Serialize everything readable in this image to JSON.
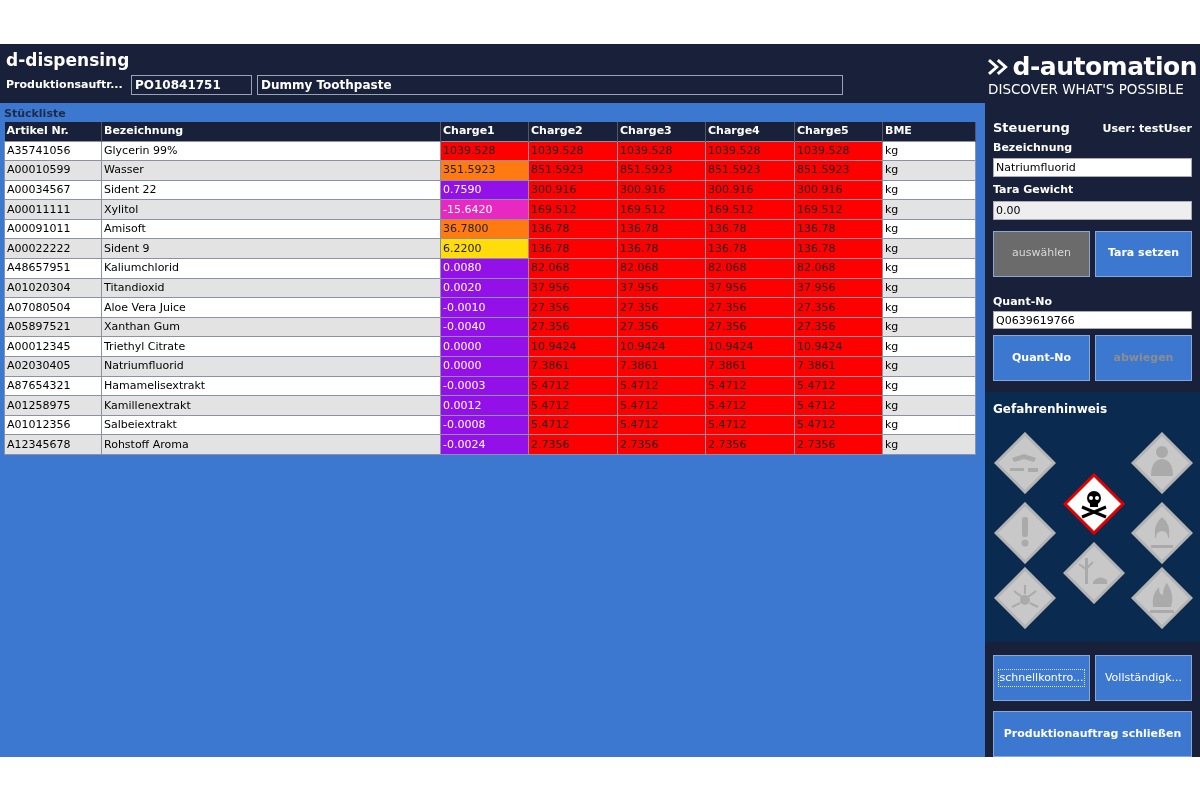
{
  "app": {
    "title": "d-dispensing"
  },
  "order": {
    "label": "Produktionsauftr...",
    "number": "PO10841751",
    "product": "Dummy Toothpaste"
  },
  "bom": {
    "title": "Stückliste",
    "columns": [
      "Artikel Nr.",
      "Bezeichnung",
      "Charge1",
      "Charge2",
      "Charge3",
      "Charge4",
      "Charge5",
      "BME"
    ],
    "rows": [
      {
        "article": "A35741056",
        "name": "Glycerin 99%",
        "charges": [
          {
            "value": "1039.528",
            "color": "#ff0000"
          },
          {
            "value": "1039.528",
            "color": "#ff0000"
          },
          {
            "value": "1039.528",
            "color": "#ff0000"
          },
          {
            "value": "1039.528",
            "color": "#ff0000"
          },
          {
            "value": "1039.528",
            "color": "#ff0000"
          }
        ],
        "unit": "kg"
      },
      {
        "article": "A00010599",
        "name": "Wasser",
        "charges": [
          {
            "value": "351.5923",
            "color": "#ff7a10"
          },
          {
            "value": "851.5923",
            "color": "#ff0000"
          },
          {
            "value": "851.5923",
            "color": "#ff0000"
          },
          {
            "value": "851.5923",
            "color": "#ff0000"
          },
          {
            "value": "851.5923",
            "color": "#ff0000"
          }
        ],
        "unit": "kg"
      },
      {
        "article": "A00034567",
        "name": "Sident 22",
        "charges": [
          {
            "value": "0.7590",
            "color": "#9410e8"
          },
          {
            "value": "300.916",
            "color": "#ff0000"
          },
          {
            "value": "300.916",
            "color": "#ff0000"
          },
          {
            "value": "300.916",
            "color": "#ff0000"
          },
          {
            "value": "300.916",
            "color": "#ff0000"
          }
        ],
        "unit": "kg"
      },
      {
        "article": "A00011111",
        "name": "Xylitol",
        "charges": [
          {
            "value": "-15.6420",
            "color": "#e828c0"
          },
          {
            "value": "169.512",
            "color": "#ff0000"
          },
          {
            "value": "169.512",
            "color": "#ff0000"
          },
          {
            "value": "169.512",
            "color": "#ff0000"
          },
          {
            "value": "169.512",
            "color": "#ff0000"
          }
        ],
        "unit": "kg"
      },
      {
        "article": "A00091011",
        "name": "Amisoft",
        "charges": [
          {
            "value": "36.7800",
            "color": "#ff7a10"
          },
          {
            "value": "136.78",
            "color": "#ff0000"
          },
          {
            "value": "136.78",
            "color": "#ff0000"
          },
          {
            "value": "136.78",
            "color": "#ff0000"
          },
          {
            "value": "136.78",
            "color": "#ff0000"
          }
        ],
        "unit": "kg"
      },
      {
        "article": "A00022222",
        "name": "Sident 9",
        "charges": [
          {
            "value": "6.2200",
            "color": "#ffdc0a"
          },
          {
            "value": "136.78",
            "color": "#ff0000"
          },
          {
            "value": "136.78",
            "color": "#ff0000"
          },
          {
            "value": "136.78",
            "color": "#ff0000"
          },
          {
            "value": "136.78",
            "color": "#ff0000"
          }
        ],
        "unit": "kg"
      },
      {
        "article": "A48657951",
        "name": "Kaliumchlorid",
        "charges": [
          {
            "value": "0.0080",
            "color": "#9410e8"
          },
          {
            "value": "82.068",
            "color": "#ff0000"
          },
          {
            "value": "82.068",
            "color": "#ff0000"
          },
          {
            "value": "82.068",
            "color": "#ff0000"
          },
          {
            "value": "82.068",
            "color": "#ff0000"
          }
        ],
        "unit": "kg"
      },
      {
        "article": "A01020304",
        "name": "Titandioxid",
        "charges": [
          {
            "value": "0.0020",
            "color": "#9410e8"
          },
          {
            "value": "37.956",
            "color": "#ff0000"
          },
          {
            "value": "37.956",
            "color": "#ff0000"
          },
          {
            "value": "37.956",
            "color": "#ff0000"
          },
          {
            "value": "37.956",
            "color": "#ff0000"
          }
        ],
        "unit": "kg"
      },
      {
        "article": "A07080504",
        "name": "Aloe Vera Juice",
        "charges": [
          {
            "value": "-0.0010",
            "color": "#9410e8"
          },
          {
            "value": "27.356",
            "color": "#ff0000"
          },
          {
            "value": "27.356",
            "color": "#ff0000"
          },
          {
            "value": "27.356",
            "color": "#ff0000"
          },
          {
            "value": "27.356",
            "color": "#ff0000"
          }
        ],
        "unit": "kg"
      },
      {
        "article": "A05897521",
        "name": "Xanthan Gum",
        "charges": [
          {
            "value": "-0.0040",
            "color": "#9410e8"
          },
          {
            "value": "27.356",
            "color": "#ff0000"
          },
          {
            "value": "27.356",
            "color": "#ff0000"
          },
          {
            "value": "27.356",
            "color": "#ff0000"
          },
          {
            "value": "27.356",
            "color": "#ff0000"
          }
        ],
        "unit": "kg"
      },
      {
        "article": "A00012345",
        "name": "Triethyl Citrate",
        "charges": [
          {
            "value": "0.0000",
            "color": "#9410e8"
          },
          {
            "value": "10.9424",
            "color": "#ff0000"
          },
          {
            "value": "10.9424",
            "color": "#ff0000"
          },
          {
            "value": "10.9424",
            "color": "#ff0000"
          },
          {
            "value": "10.9424",
            "color": "#ff0000"
          }
        ],
        "unit": "kg"
      },
      {
        "article": "A02030405",
        "name": "Natriumfluorid",
        "charges": [
          {
            "value": "0.0000",
            "color": "#9410e8"
          },
          {
            "value": "7.3861",
            "color": "#ff0000"
          },
          {
            "value": "7.3861",
            "color": "#ff0000"
          },
          {
            "value": "7.3861",
            "color": "#ff0000"
          },
          {
            "value": "7.3861",
            "color": "#ff0000"
          }
        ],
        "unit": "kg"
      },
      {
        "article": "A87654321",
        "name": "Hamamelisextrakt",
        "charges": [
          {
            "value": "-0.0003",
            "color": "#9410e8"
          },
          {
            "value": "5.4712",
            "color": "#ff0000"
          },
          {
            "value": "5.4712",
            "color": "#ff0000"
          },
          {
            "value": "5.4712",
            "color": "#ff0000"
          },
          {
            "value": "5.4712",
            "color": "#ff0000"
          }
        ],
        "unit": "kg"
      },
      {
        "article": "A01258975",
        "name": "Kamillenextrakt",
        "charges": [
          {
            "value": "0.0012",
            "color": "#9410e8"
          },
          {
            "value": "5.4712",
            "color": "#ff0000"
          },
          {
            "value": "5.4712",
            "color": "#ff0000"
          },
          {
            "value": "5.4712",
            "color": "#ff0000"
          },
          {
            "value": "5.4712",
            "color": "#ff0000"
          }
        ],
        "unit": "kg"
      },
      {
        "article": "A01012356",
        "name": "Salbeiextrakt",
        "charges": [
          {
            "value": "-0.0008",
            "color": "#9410e8"
          },
          {
            "value": "5.4712",
            "color": "#ff0000"
          },
          {
            "value": "5.4712",
            "color": "#ff0000"
          },
          {
            "value": "5.4712",
            "color": "#ff0000"
          },
          {
            "value": "5.4712",
            "color": "#ff0000"
          }
        ],
        "unit": "kg"
      },
      {
        "article": "A12345678",
        "name": "Rohstoff Aroma",
        "charges": [
          {
            "value": "-0.0024",
            "color": "#9410e8"
          },
          {
            "value": "2.7356",
            "color": "#ff0000"
          },
          {
            "value": "2.7356",
            "color": "#ff0000"
          },
          {
            "value": "2.7356",
            "color": "#ff0000"
          },
          {
            "value": "2.7356",
            "color": "#ff0000"
          }
        ],
        "unit": "kg"
      }
    ]
  },
  "brand": {
    "name": "d-automation",
    "slogan": "DISCOVER WHAT'S POSSIBLE"
  },
  "control": {
    "title": "Steuerung",
    "user": "User: testUser",
    "name_label": "Bezeichnung",
    "name_value": "Natriumfluorid",
    "tare_label": "Tara Gewicht",
    "tare_value": "0.00",
    "tare_readonly": true,
    "buttons_top": [
      {
        "label": "auswählen",
        "kind": "neutral",
        "disabled": false
      },
      {
        "label": "Tara setzen",
        "kind": "primary",
        "disabled": false
      }
    ],
    "quant_label": "Quant-No",
    "quant_value": "Q0639619766",
    "buttons_quant": [
      {
        "label": "Quant-No",
        "kind": "primary",
        "disabled": false
      },
      {
        "label": "abwiegen",
        "kind": "primary",
        "disabled": true
      }
    ]
  },
  "hazards": {
    "title": "Gefahrenhinweis",
    "pictograms": [
      {
        "kind": "corrosive",
        "active": false
      },
      {
        "kind": "health",
        "active": false
      },
      {
        "kind": "toxic",
        "active": true
      },
      {
        "kind": "exclamation",
        "active": false
      },
      {
        "kind": "oxidizer",
        "active": false
      },
      {
        "kind": "environment",
        "active": false
      },
      {
        "kind": "explosive",
        "active": false
      },
      {
        "kind": "flammable",
        "active": false
      }
    ]
  },
  "footer_buttons": [
    {
      "label": "schnellkontro...",
      "focused": true
    },
    {
      "label": "Vollständigk...",
      "focused": false
    }
  ],
  "close_button": {
    "label": "Produktionauftrag schließen"
  }
}
